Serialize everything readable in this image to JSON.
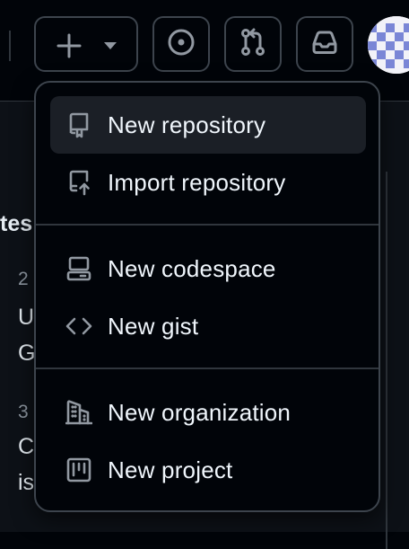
{
  "header": {
    "create_button": {
      "plus_icon": "plus-icon",
      "caret_icon": "triangle-down-icon"
    },
    "issues_button": {
      "icon": "issue-opened-icon"
    },
    "pulls_button": {
      "icon": "git-pull-request-icon"
    },
    "inbox_button": {
      "icon": "inbox-icon"
    },
    "avatar": {
      "icon": "identicon-avatar"
    }
  },
  "background": {
    "heading_fragment": "tes",
    "lines": [
      "2",
      "U",
      "G",
      "3",
      "C",
      "is"
    ]
  },
  "menu": {
    "items": [
      {
        "label": "New repository",
        "icon": "repo-icon"
      },
      {
        "label": "Import repository",
        "icon": "repo-push-icon"
      },
      {
        "label": "New codespace",
        "icon": "codespaces-icon"
      },
      {
        "label": "New gist",
        "icon": "code-icon"
      },
      {
        "label": "New organization",
        "icon": "organization-icon"
      },
      {
        "label": "New project",
        "icon": "project-icon"
      }
    ]
  },
  "colors": {
    "background": "#010409",
    "menu_border": "#3d444d",
    "icon": "#9198a1",
    "text": "#f0f6fc",
    "active_item": "#1b1f26"
  }
}
